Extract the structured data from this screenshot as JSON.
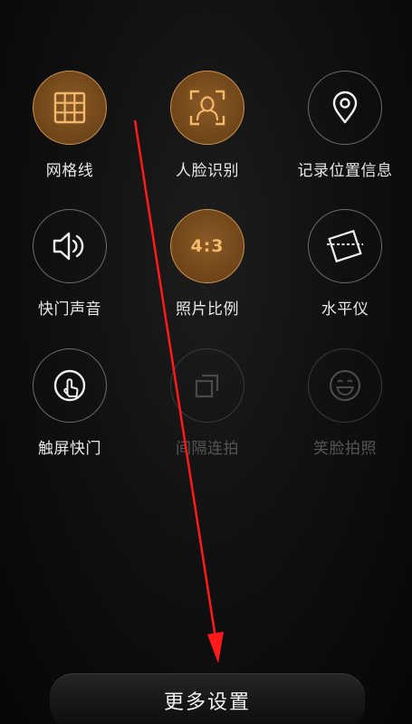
{
  "settings": [
    {
      "label": "网格线",
      "icon": "grid-icon",
      "state": "active"
    },
    {
      "label": "人脸识别",
      "icon": "face-recognition-icon",
      "state": "active"
    },
    {
      "label": "记录位置信息",
      "icon": "location-pin-icon",
      "state": "normal"
    },
    {
      "label": "快门声音",
      "icon": "speaker-icon",
      "state": "normal"
    },
    {
      "label": "照片比例",
      "icon": "aspect-ratio-icon",
      "state": "active",
      "icon_text": "4:3"
    },
    {
      "label": "水平仪",
      "icon": "level-icon",
      "state": "normal"
    },
    {
      "label": "触屏快门",
      "icon": "touch-shutter-icon",
      "state": "normal"
    },
    {
      "label": "间隔连拍",
      "icon": "interval-burst-icon",
      "state": "disabled"
    },
    {
      "label": "笑脸拍照",
      "icon": "smile-icon",
      "state": "disabled"
    }
  ],
  "more_settings_label": "更多设置",
  "colors": {
    "accent": "#f4b86a",
    "active_fill": "#6e4519",
    "arrow": "#ff1a1a"
  }
}
